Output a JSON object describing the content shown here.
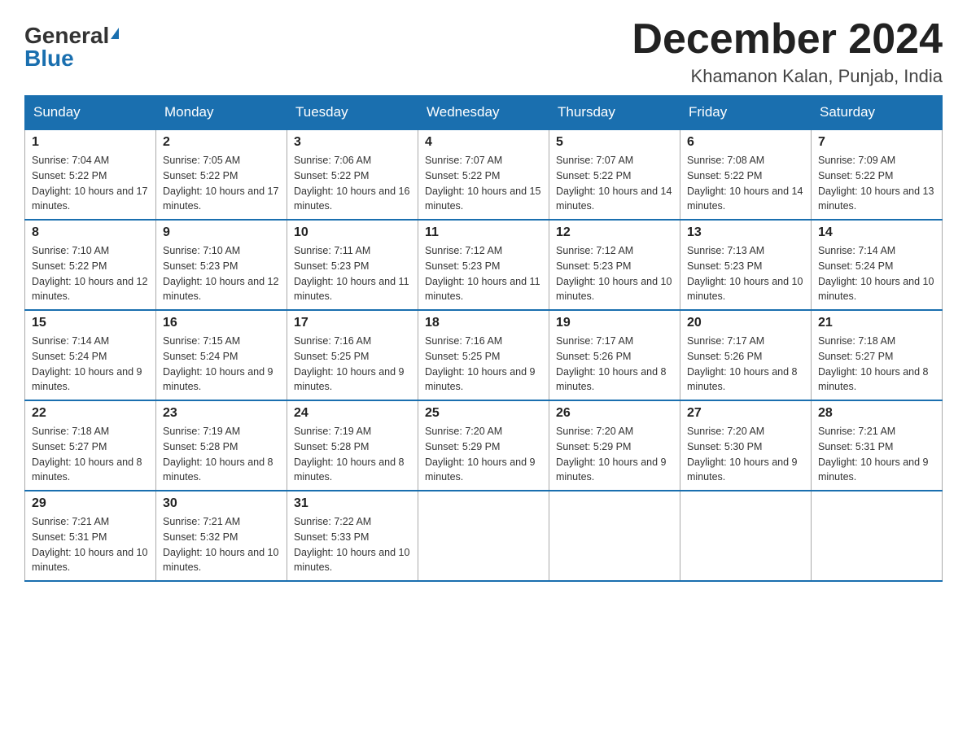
{
  "logo": {
    "general": "General",
    "blue": "Blue"
  },
  "title": "December 2024",
  "location": "Khamanon Kalan, Punjab, India",
  "days_of_week": [
    "Sunday",
    "Monday",
    "Tuesday",
    "Wednesday",
    "Thursday",
    "Friday",
    "Saturday"
  ],
  "weeks": [
    [
      {
        "day": "1",
        "sunrise": "7:04 AM",
        "sunset": "5:22 PM",
        "daylight": "10 hours and 17 minutes."
      },
      {
        "day": "2",
        "sunrise": "7:05 AM",
        "sunset": "5:22 PM",
        "daylight": "10 hours and 17 minutes."
      },
      {
        "day": "3",
        "sunrise": "7:06 AM",
        "sunset": "5:22 PM",
        "daylight": "10 hours and 16 minutes."
      },
      {
        "day": "4",
        "sunrise": "7:07 AM",
        "sunset": "5:22 PM",
        "daylight": "10 hours and 15 minutes."
      },
      {
        "day": "5",
        "sunrise": "7:07 AM",
        "sunset": "5:22 PM",
        "daylight": "10 hours and 14 minutes."
      },
      {
        "day": "6",
        "sunrise": "7:08 AM",
        "sunset": "5:22 PM",
        "daylight": "10 hours and 14 minutes."
      },
      {
        "day": "7",
        "sunrise": "7:09 AM",
        "sunset": "5:22 PM",
        "daylight": "10 hours and 13 minutes."
      }
    ],
    [
      {
        "day": "8",
        "sunrise": "7:10 AM",
        "sunset": "5:22 PM",
        "daylight": "10 hours and 12 minutes."
      },
      {
        "day": "9",
        "sunrise": "7:10 AM",
        "sunset": "5:23 PM",
        "daylight": "10 hours and 12 minutes."
      },
      {
        "day": "10",
        "sunrise": "7:11 AM",
        "sunset": "5:23 PM",
        "daylight": "10 hours and 11 minutes."
      },
      {
        "day": "11",
        "sunrise": "7:12 AM",
        "sunset": "5:23 PM",
        "daylight": "10 hours and 11 minutes."
      },
      {
        "day": "12",
        "sunrise": "7:12 AM",
        "sunset": "5:23 PM",
        "daylight": "10 hours and 10 minutes."
      },
      {
        "day": "13",
        "sunrise": "7:13 AM",
        "sunset": "5:23 PM",
        "daylight": "10 hours and 10 minutes."
      },
      {
        "day": "14",
        "sunrise": "7:14 AM",
        "sunset": "5:24 PM",
        "daylight": "10 hours and 10 minutes."
      }
    ],
    [
      {
        "day": "15",
        "sunrise": "7:14 AM",
        "sunset": "5:24 PM",
        "daylight": "10 hours and 9 minutes."
      },
      {
        "day": "16",
        "sunrise": "7:15 AM",
        "sunset": "5:24 PM",
        "daylight": "10 hours and 9 minutes."
      },
      {
        "day": "17",
        "sunrise": "7:16 AM",
        "sunset": "5:25 PM",
        "daylight": "10 hours and 9 minutes."
      },
      {
        "day": "18",
        "sunrise": "7:16 AM",
        "sunset": "5:25 PM",
        "daylight": "10 hours and 9 minutes."
      },
      {
        "day": "19",
        "sunrise": "7:17 AM",
        "sunset": "5:26 PM",
        "daylight": "10 hours and 8 minutes."
      },
      {
        "day": "20",
        "sunrise": "7:17 AM",
        "sunset": "5:26 PM",
        "daylight": "10 hours and 8 minutes."
      },
      {
        "day": "21",
        "sunrise": "7:18 AM",
        "sunset": "5:27 PM",
        "daylight": "10 hours and 8 minutes."
      }
    ],
    [
      {
        "day": "22",
        "sunrise": "7:18 AM",
        "sunset": "5:27 PM",
        "daylight": "10 hours and 8 minutes."
      },
      {
        "day": "23",
        "sunrise": "7:19 AM",
        "sunset": "5:28 PM",
        "daylight": "10 hours and 8 minutes."
      },
      {
        "day": "24",
        "sunrise": "7:19 AM",
        "sunset": "5:28 PM",
        "daylight": "10 hours and 8 minutes."
      },
      {
        "day": "25",
        "sunrise": "7:20 AM",
        "sunset": "5:29 PM",
        "daylight": "10 hours and 9 minutes."
      },
      {
        "day": "26",
        "sunrise": "7:20 AM",
        "sunset": "5:29 PM",
        "daylight": "10 hours and 9 minutes."
      },
      {
        "day": "27",
        "sunrise": "7:20 AM",
        "sunset": "5:30 PM",
        "daylight": "10 hours and 9 minutes."
      },
      {
        "day": "28",
        "sunrise": "7:21 AM",
        "sunset": "5:31 PM",
        "daylight": "10 hours and 9 minutes."
      }
    ],
    [
      {
        "day": "29",
        "sunrise": "7:21 AM",
        "sunset": "5:31 PM",
        "daylight": "10 hours and 10 minutes."
      },
      {
        "day": "30",
        "sunrise": "7:21 AM",
        "sunset": "5:32 PM",
        "daylight": "10 hours and 10 minutes."
      },
      {
        "day": "31",
        "sunrise": "7:22 AM",
        "sunset": "5:33 PM",
        "daylight": "10 hours and 10 minutes."
      },
      null,
      null,
      null,
      null
    ]
  ]
}
